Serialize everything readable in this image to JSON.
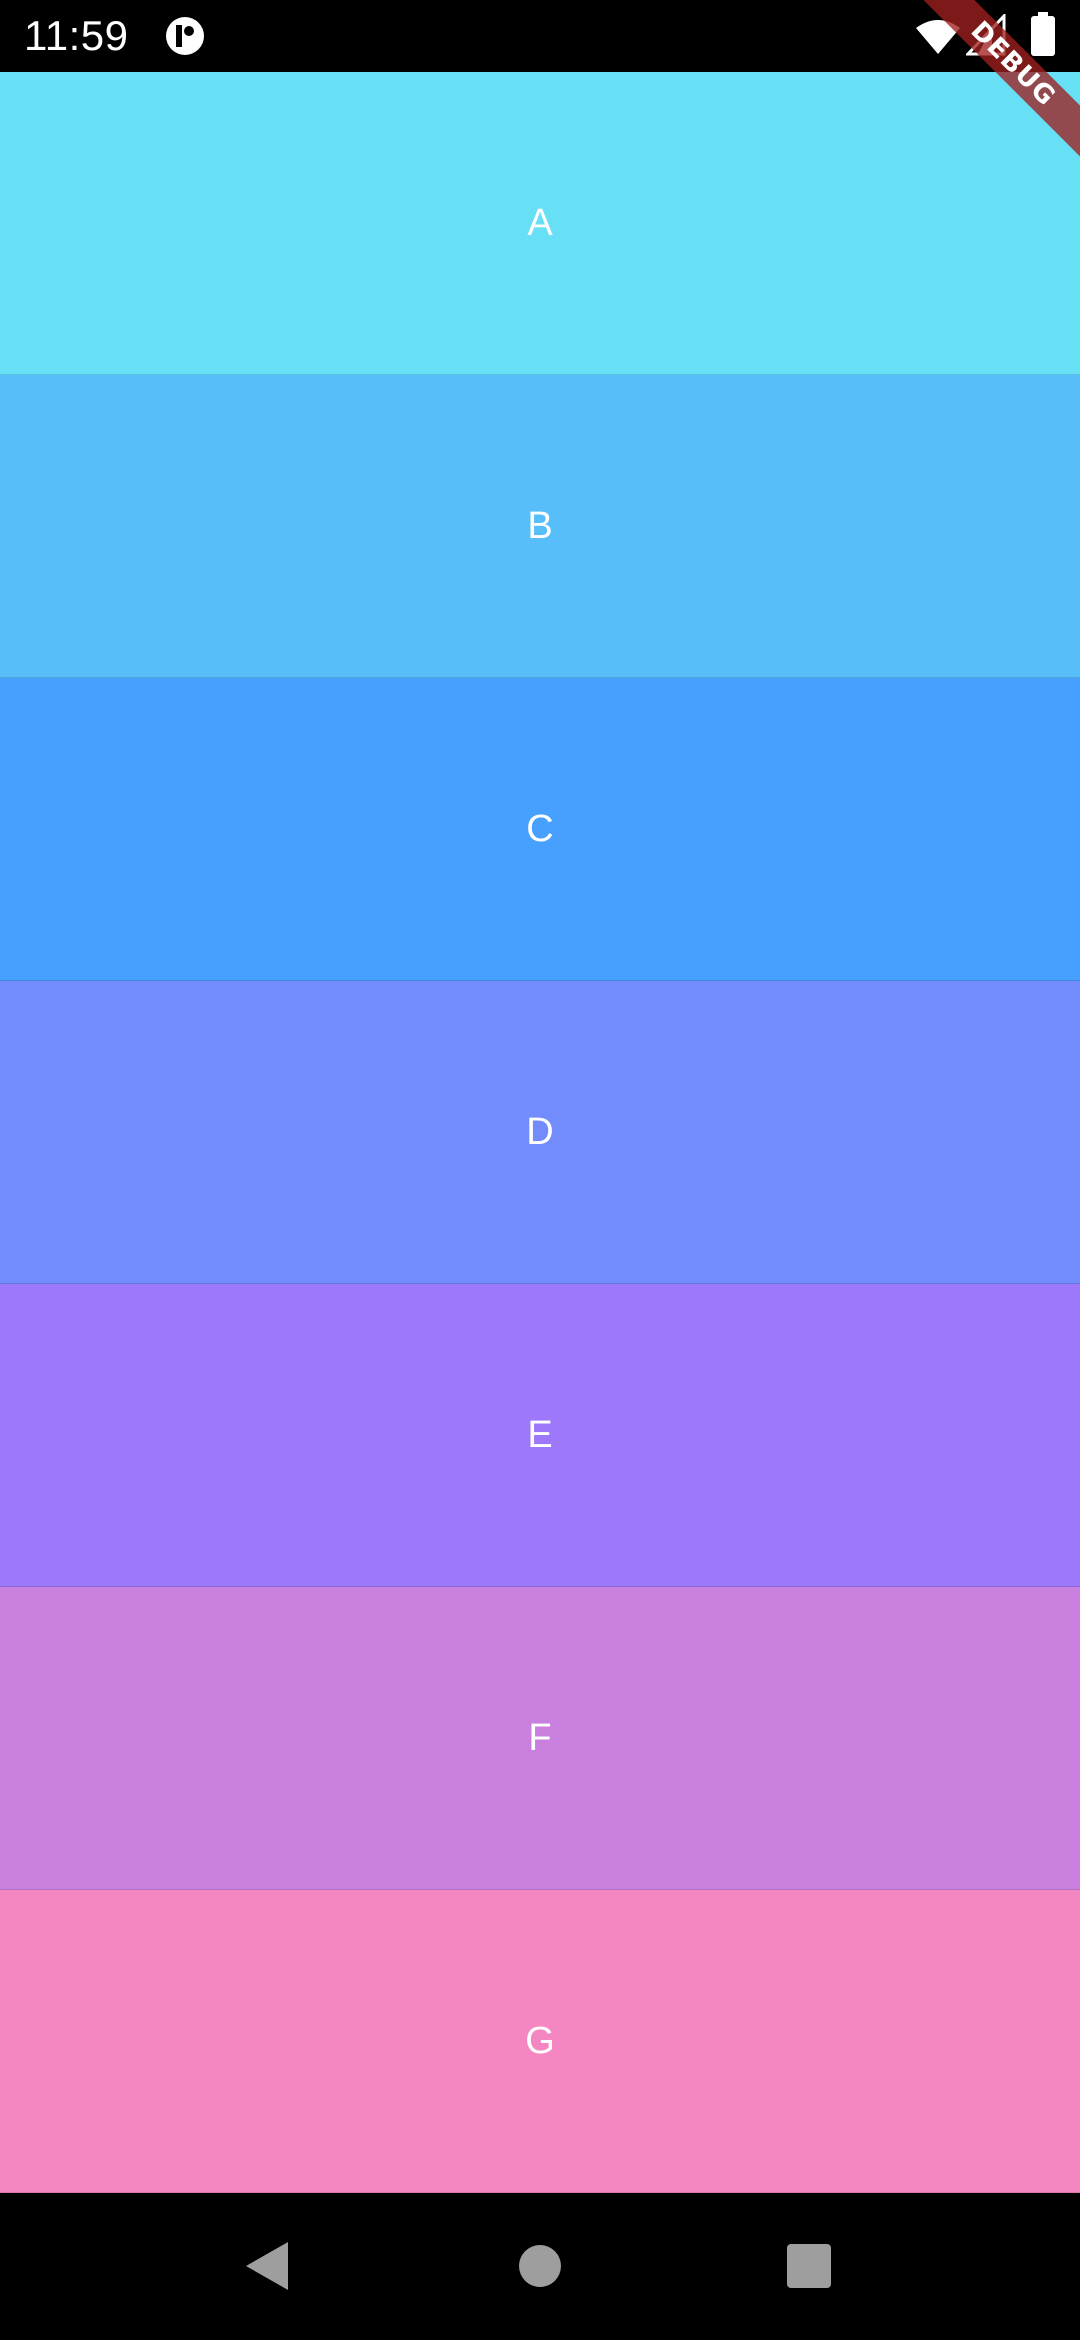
{
  "status_bar": {
    "time": "11:59",
    "icons": [
      "app-notification-icon",
      "wifi-icon",
      "signal-icon",
      "battery-icon"
    ]
  },
  "debug_banner": {
    "label": "DEBUG",
    "color": "#A02020"
  },
  "list": {
    "items": [
      {
        "label": "A",
        "color": "#67E0F6"
      },
      {
        "label": "B",
        "color": "#58BEFA"
      },
      {
        "label": "C",
        "color": "#48A0FE"
      },
      {
        "label": "D",
        "color": "#728CFC"
      },
      {
        "label": "E",
        "color": "#9E78FA"
      },
      {
        "label": "F",
        "color": "#C87FDE"
      },
      {
        "label": "G",
        "color": "#F487C2"
      }
    ]
  },
  "nav_bar": {
    "icons": [
      "back-icon",
      "home-icon",
      "recents-icon"
    ]
  }
}
